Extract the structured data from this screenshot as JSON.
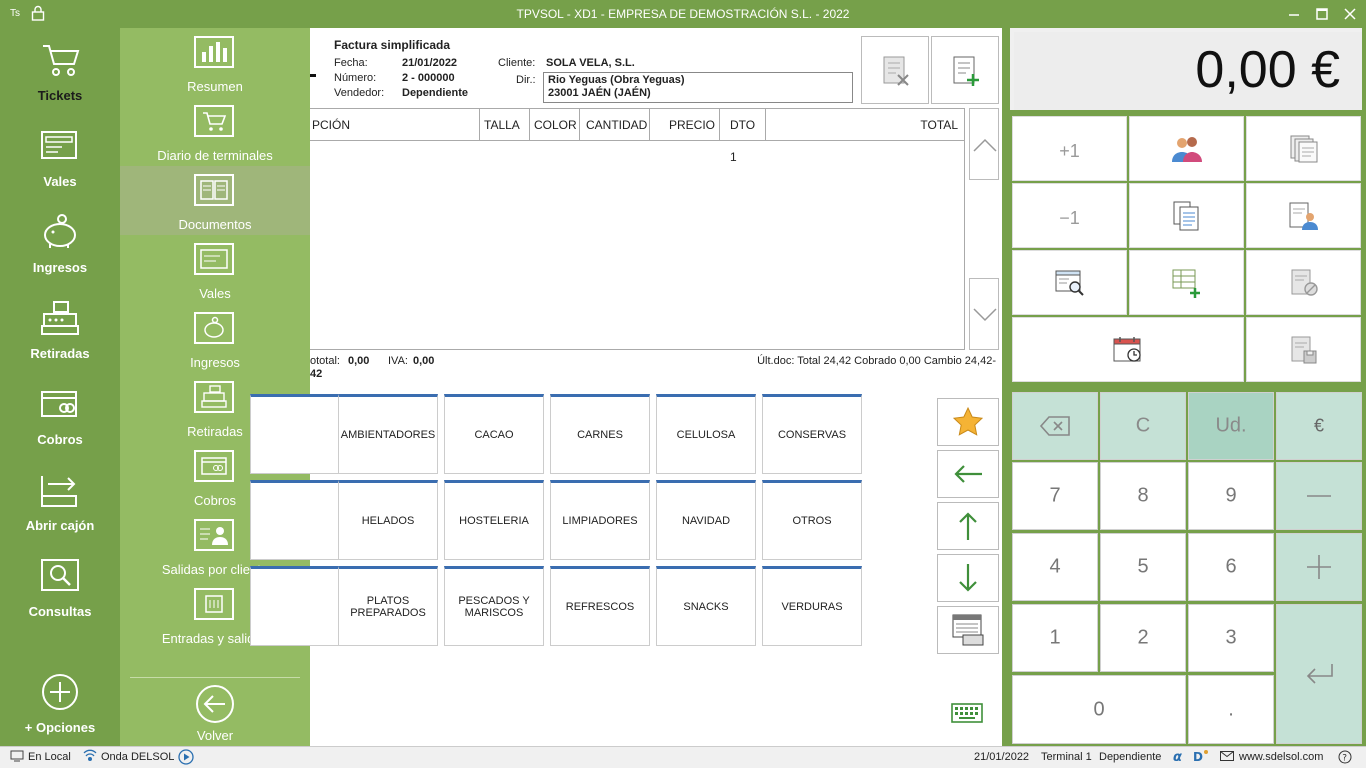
{
  "titlebar": {
    "user_initials": "Ts",
    "title": "TPVSOL - XD1 - EMPRESA DE DEMOSTRACIÓN S.L. - 2022"
  },
  "leftnav": {
    "items": [
      {
        "label": "Tickets",
        "icon": "cart-icon"
      },
      {
        "label": "Vales",
        "icon": "voucher-icon"
      },
      {
        "label": "Ingresos",
        "icon": "piggy-bank-icon"
      },
      {
        "label": "Retiradas",
        "icon": "cash-register-icon"
      },
      {
        "label": "Cobros",
        "icon": "card-payment-icon"
      },
      {
        "label": "Abrir cajón",
        "icon": "open-drawer-icon"
      },
      {
        "label": "Consultas",
        "icon": "magnifier-icon"
      }
    ],
    "options_label": "+ Opciones"
  },
  "submenu": {
    "items": [
      {
        "label": "Resumen",
        "icon": "bar-chart-icon"
      },
      {
        "label": "Diario de terminales",
        "icon": "cart-terminal-icon"
      },
      {
        "label": "Documentos",
        "icon": "documents-icon"
      },
      {
        "label": "Vales",
        "icon": "voucher-icon"
      },
      {
        "label": "Ingresos",
        "icon": "piggy-bank-icon"
      },
      {
        "label": "Retiradas",
        "icon": "cash-register-icon"
      },
      {
        "label": "Cobros",
        "icon": "card-payment-icon"
      },
      {
        "label": "Salidas por cliente",
        "icon": "client-icon"
      },
      {
        "label": "Entradas y salidas",
        "icon": "in-out-icon"
      }
    ],
    "back_label": "Volver"
  },
  "document": {
    "type": "Factura simplificada",
    "fecha_label": "Fecha:",
    "fecha": "21/01/2022",
    "numero_label": "Número:",
    "numero": "2 - 000000",
    "vendedor_label": "Vendedor:",
    "vendedor": "Dependiente",
    "cliente_label": "Cliente:",
    "cliente": "SOLA VELA, S.L.",
    "dir_label": "Dir.:",
    "dir_line1": "Rio Yeguas (Obra Yeguas)",
    "dir_line2": "23001 JAÉN (JAÉN)",
    "columns": [
      "PCIÓN",
      "TALLA",
      "COLOR",
      "CANTIDAD",
      "PRECIO",
      "DTO 1",
      "TOTAL"
    ],
    "subtotal_label": "ototal:",
    "subtotal": "0,00",
    "iva_label": "IVA:",
    "iva": "0,00",
    "subtotal_cont": "42",
    "last_doc": "Últ.doc: Total 24,42 Cobrado 0,00 Cambio 24,42-"
  },
  "display": {
    "amount": "0,00 €"
  },
  "actions": {
    "plus_one": "+1",
    "minus_one": "−1"
  },
  "families": [
    [
      "AMBIENTADORES",
      "CACAO",
      "CARNES",
      "CELULOSA",
      "CONSERVAS"
    ],
    [
      "HELADOS",
      "HOSTELERIA",
      "LIMPIADORES",
      "NAVIDAD",
      "OTROS"
    ],
    [
      "PLATOS PREPARADOS",
      "PESCADOS Y MARISCOS",
      "REFRESCOS",
      "SNACKS",
      "VERDURAS"
    ]
  ],
  "keypad": {
    "clear": "C",
    "units": "Ud.",
    "euro": "€",
    "k7": "7",
    "k8": "8",
    "k9": "9",
    "k4": "4",
    "k5": "5",
    "k6": "6",
    "k1": "1",
    "k2": "2",
    "k3": "3",
    "k0": "0",
    "dot": "."
  },
  "statusbar": {
    "local": "En Local",
    "onda": "Onda DELSOL",
    "date": "21/01/2022",
    "terminal": "Terminal 1",
    "user": "Dependiente",
    "website": "www.sdelsol.com"
  },
  "colors": {
    "nav_green": "#76a04a",
    "submenu_green": "#94bb63",
    "family_accent": "#3a6db0",
    "keypad_teal": "#c5e1d6"
  }
}
